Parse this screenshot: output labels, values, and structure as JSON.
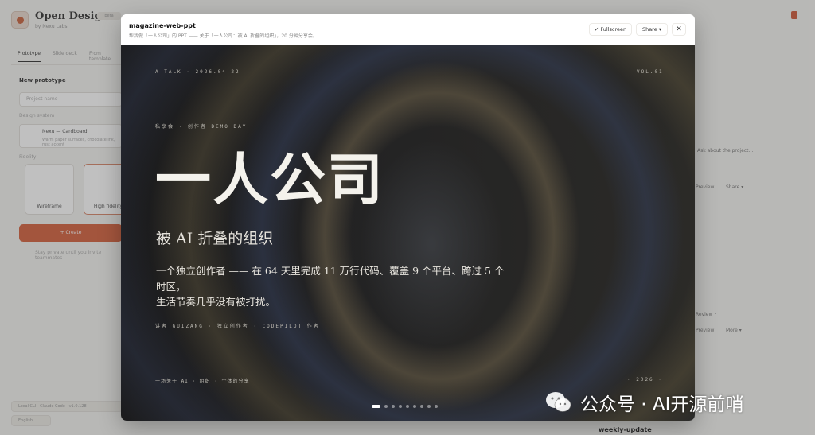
{
  "background_app": {
    "title": "Open Design",
    "subtitle": "by Nexu Labs",
    "badge": "beta",
    "tabs": [
      {
        "label": "Prototype"
      },
      {
        "label": "Slide deck"
      },
      {
        "label": "From template"
      }
    ],
    "new_prototype_label": "New prototype",
    "project_name_placeholder": "Project name",
    "design_system_label": "Design system",
    "design_system_name": "Nexu — Cardboard",
    "design_system_desc": "Warm paper surfaces, chocolate ink, rust accent",
    "fidelity_label": "Fidelity",
    "fidelity_options": [
      {
        "label": "Wireframe"
      },
      {
        "label": "High fidelity"
      }
    ],
    "create_button": "+ Create",
    "create_hint": "Stay private until you invite teammates",
    "footer_pills": [
      "Local CLI · Claude Code · v1.0.128",
      "English"
    ],
    "right_texts": [
      "Ask about the project…",
      "Preview",
      "Share ▾",
      "Review ·",
      "Preview",
      "More ▾"
    ],
    "weekly_update": "weekly-update"
  },
  "modal": {
    "title": "magazine-web-ppt",
    "subtitle": "帮我做「一人公司」的 PPT —— 关于「一人公司：被 AI 折叠的组织」，20 分钟分享会。…",
    "buttons": {
      "fullscreen": "✓ Fullscreen",
      "share": "Share ▾",
      "close": "✕"
    }
  },
  "slide": {
    "meta_left": "A TALK · 2026.04.22",
    "meta_right": "VOL.01",
    "kicker": "私享会 · 创作者 DEMO DAY",
    "headline": "一人公司",
    "subheadline": "被 AI 折叠的组织",
    "body_lines": [
      "一个独立创作者 —— 在 64 天里完成 11 万行代码、覆盖 9 个平台、跨过 5 个",
      "时区，",
      "生活节奏几乎没有被打扰。"
    ],
    "byline": "讲者 GUIZANG · 独立创作者 · CODEPILOT 作者",
    "footer_left": "一场关于 AI · 组织 · 个体的分享",
    "footer_right": "· 2026 ·",
    "pagination": {
      "total": 9,
      "current": 1
    }
  },
  "watermark": {
    "text": "公众号 · AI开源前哨",
    "icon": "wechat-icon"
  }
}
